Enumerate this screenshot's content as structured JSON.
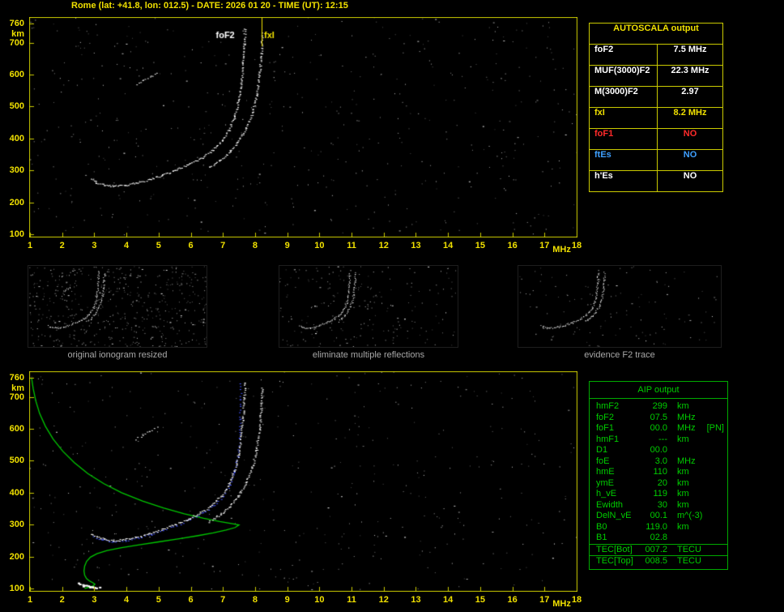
{
  "header": {
    "title": "Rome (lat: +41.8, lon: 012.5) - DATE: 2026 01 20 - TIME (UT): 12:15"
  },
  "colors": {
    "white": "#ffffff",
    "yellow": "#f0e000",
    "red": "#ff2a2a",
    "blue": "#3fa0ff",
    "axis_yellow": "#caca00",
    "green": "#00cc00",
    "green_border": "#00aa00",
    "profile_green": "#00c800",
    "fit_blue": "#4455ff",
    "caption_gray": "#a8a8a8"
  },
  "autoscala_table": {
    "title": "AUTOSCALA output",
    "rows": [
      {
        "label": "foF2",
        "value": "7.5 MHz",
        "color": "white"
      },
      {
        "label": "MUF(3000)F2",
        "value": "22.3 MHz",
        "color": "white"
      },
      {
        "label": "M(3000)F2",
        "value": "2.97",
        "color": "white"
      },
      {
        "label": "fxI",
        "value": "8.2 MHz",
        "color": "yellow"
      },
      {
        "label": "foF1",
        "value": "NO",
        "color": "red"
      },
      {
        "label": "ftEs",
        "value": "NO",
        "color": "blue"
      },
      {
        "label": "h'Es",
        "value": "NO",
        "color": "white"
      }
    ]
  },
  "thumbnails": [
    {
      "caption": "original ionogram resized"
    },
    {
      "caption": "eliminate multiple reflections"
    },
    {
      "caption": "evidence F2 trace"
    }
  ],
  "aip_table": {
    "title": "AIP output",
    "rows": [
      {
        "label": "hmF2",
        "value": "299",
        "unit": "km"
      },
      {
        "label": "foF2",
        "value": "07.5",
        "unit": "MHz"
      },
      {
        "label": "foF1",
        "value": "00.0",
        "unit": "MHz",
        "note": "[PN]"
      },
      {
        "label": "hmF1",
        "value": "---",
        "unit": "km"
      },
      {
        "label": "D1",
        "value": "00.0",
        "unit": ""
      },
      {
        "label": "foE",
        "value": "3.0",
        "unit": "MHz"
      },
      {
        "label": "hmE",
        "value": "110",
        "unit": "km"
      },
      {
        "label": "ymE",
        "value": "20",
        "unit": "km"
      },
      {
        "label": "h_vE",
        "value": "119",
        "unit": "km"
      },
      {
        "label": "Ewidth",
        "value": "30",
        "unit": "km"
      },
      {
        "label": "DelN_vE",
        "value": "00.1",
        "unit": "m^(-3)"
      },
      {
        "label": "B0",
        "value": "119.0",
        "unit": "km"
      },
      {
        "label": "B1",
        "value": "02.8",
        "unit": ""
      },
      {
        "label": "TEC[Bot]",
        "value": "007.2",
        "unit": "TECU",
        "sep": true
      },
      {
        "label": "TEC[Top]",
        "value": "008.5",
        "unit": "TECU",
        "sep": true
      }
    ]
  },
  "chart_data": [
    {
      "id": "scaled-ionogram",
      "type": "scatter",
      "xlabel": "MHz",
      "ylabel": "km",
      "xlim": [
        1,
        18
      ],
      "ylim": [
        100,
        760
      ],
      "x_ticks": [
        1,
        2,
        3,
        4,
        5,
        6,
        7,
        8,
        9,
        10,
        11,
        12,
        13,
        14,
        15,
        16,
        17,
        18
      ],
      "y_ticks": [
        760,
        700,
        600,
        500,
        400,
        300,
        200,
        100
      ],
      "key_values": {
        "foF2_MHz": 7.5,
        "fxI_MHz": 8.2
      },
      "annotations": [
        {
          "text": "foF2",
          "x": 6.78,
          "km": 722,
          "color": "#ffffff"
        },
        {
          "text": "fxI",
          "x": 8.28,
          "km": 722,
          "color": "#f0e000"
        }
      ],
      "markers": [
        {
          "x": 8.2,
          "km_to": 690,
          "color": "#f0e000"
        }
      ],
      "series": [
        {
          "name": "F2 O-mode echo trace",
          "color": "#ffffff",
          "style": "trace",
          "points": [
            [
              2.88,
              272
            ],
            [
              3.05,
              262
            ],
            [
              3.3,
              255
            ],
            [
              3.6,
              251
            ],
            [
              3.95,
              254
            ],
            [
              4.3,
              261
            ],
            [
              4.7,
              272
            ],
            [
              5.1,
              286
            ],
            [
              5.5,
              301
            ],
            [
              5.9,
              318
            ],
            [
              6.3,
              338
            ],
            [
              6.65,
              362
            ],
            [
              6.95,
              392
            ],
            [
              7.18,
              428
            ],
            [
              7.35,
              470
            ],
            [
              7.47,
              520
            ],
            [
              7.55,
              575
            ],
            [
              7.61,
              635
            ],
            [
              7.65,
              695
            ],
            [
              7.67,
              745
            ]
          ]
        },
        {
          "name": "F2 X-mode echo trace",
          "color": "#ffffff",
          "style": "trace",
          "points": [
            [
              6.55,
              310
            ],
            [
              6.9,
              332
            ],
            [
              7.2,
              358
            ],
            [
              7.45,
              390
            ],
            [
              7.7,
              432
            ],
            [
              7.9,
              480
            ],
            [
              8.03,
              535
            ],
            [
              8.12,
              600
            ],
            [
              8.18,
              665
            ],
            [
              8.21,
              730
            ]
          ]
        },
        {
          "name": "second-hop echo",
          "color": "#dcdcdc",
          "style": "trace",
          "step": 3,
          "points": [
            [
              4.28,
              568
            ],
            [
              4.5,
              582
            ],
            [
              4.72,
              594
            ],
            [
              4.95,
              606
            ]
          ]
        }
      ]
    },
    {
      "id": "ionogram-with-electron-density-profile",
      "type": "scatter",
      "xlabel": "MHz",
      "ylabel": "km",
      "xlim": [
        1,
        18
      ],
      "ylim": [
        100,
        760
      ],
      "x_ticks": [
        1,
        2,
        3,
        4,
        5,
        6,
        7,
        8,
        9,
        10,
        11,
        12,
        13,
        14,
        15,
        16,
        17,
        18
      ],
      "y_ticks": [
        760,
        700,
        600,
        500,
        400,
        300,
        200,
        100
      ],
      "key_values": {
        "hmF2_km": 299,
        "foF2_MHz": 7.5,
        "foE_MHz": 3.0,
        "hmE_km": 110
      },
      "annotations": [],
      "markers": [],
      "series": [
        {
          "name": "electron density profile",
          "color": "#00c800",
          "style": "line",
          "points": [
            [
              1.05,
              760
            ],
            [
              1.1,
              726
            ],
            [
              1.18,
              688
            ],
            [
              1.3,
              648
            ],
            [
              1.48,
              608
            ],
            [
              1.72,
              568
            ],
            [
              2.02,
              530
            ],
            [
              2.38,
              494
            ],
            [
              2.8,
              460
            ],
            [
              3.3,
              428
            ],
            [
              3.85,
              400
            ],
            [
              4.5,
              374
            ],
            [
              5.15,
              352
            ],
            [
              5.8,
              334
            ],
            [
              6.4,
              320
            ],
            [
              6.9,
              310
            ],
            [
              7.3,
              303
            ],
            [
              7.5,
              299
            ],
            [
              7.38,
              291
            ],
            [
              7.1,
              283
            ],
            [
              6.7,
              274
            ],
            [
              6.2,
              265
            ],
            [
              5.6,
              255
            ],
            [
              5.0,
              246
            ],
            [
              4.4,
              237
            ],
            [
              3.85,
              228
            ],
            [
              3.4,
              219
            ],
            [
              3.08,
              209
            ],
            [
              2.88,
              198
            ],
            [
              2.76,
              185
            ],
            [
              2.7,
              170
            ],
            [
              2.68,
              155
            ],
            [
              2.7,
              142
            ],
            [
              2.76,
              131
            ],
            [
              2.86,
              123
            ],
            [
              2.97,
              117
            ],
            [
              3.02,
              113
            ],
            [
              2.96,
              108
            ],
            [
              2.84,
              104
            ],
            [
              2.7,
              100
            ]
          ]
        },
        {
          "name": "AUTOSCALA fitted trace",
          "color": "#4455ff",
          "style": "trace",
          "step": 4,
          "points": [
            [
              2.95,
              262
            ],
            [
              3.2,
              253
            ],
            [
              3.55,
              248
            ],
            [
              3.95,
              251
            ],
            [
              4.35,
              259
            ],
            [
              4.75,
              270
            ],
            [
              5.15,
              284
            ],
            [
              5.55,
              299
            ],
            [
              5.95,
              316
            ],
            [
              6.35,
              336
            ],
            [
              6.7,
              360
            ],
            [
              7.0,
              390
            ],
            [
              7.2,
              425
            ],
            [
              7.35,
              465
            ],
            [
              7.45,
              515
            ],
            [
              7.5,
              570
            ],
            [
              7.52,
              630
            ],
            [
              7.53,
              690
            ],
            [
              7.54,
              745
            ]
          ]
        },
        {
          "name": "F2 O-mode echo trace",
          "color": "#ffffff",
          "style": "trace",
          "points": [
            [
              2.88,
              272
            ],
            [
              3.05,
              262
            ],
            [
              3.3,
              255
            ],
            [
              3.6,
              251
            ],
            [
              3.95,
              254
            ],
            [
              4.3,
              261
            ],
            [
              4.7,
              272
            ],
            [
              5.1,
              286
            ],
            [
              5.5,
              301
            ],
            [
              5.9,
              318
            ],
            [
              6.3,
              338
            ],
            [
              6.65,
              362
            ],
            [
              6.95,
              392
            ],
            [
              7.18,
              428
            ],
            [
              7.35,
              470
            ],
            [
              7.47,
              520
            ],
            [
              7.55,
              575
            ],
            [
              7.61,
              635
            ],
            [
              7.65,
              695
            ],
            [
              7.67,
              745
            ]
          ]
        },
        {
          "name": "F2 X-mode echo trace",
          "color": "#ffffff",
          "style": "trace",
          "points": [
            [
              6.55,
              310
            ],
            [
              6.9,
              332
            ],
            [
              7.2,
              358
            ],
            [
              7.45,
              390
            ],
            [
              7.7,
              432
            ],
            [
              7.9,
              480
            ],
            [
              8.03,
              535
            ],
            [
              8.12,
              600
            ],
            [
              8.18,
              665
            ],
            [
              8.21,
              730
            ]
          ]
        },
        {
          "name": "second-hop echo",
          "color": "#dcdcdc",
          "style": "trace",
          "step": 3,
          "points": [
            [
              4.28,
              568
            ],
            [
              4.5,
              582
            ],
            [
              4.72,
              594
            ],
            [
              4.95,
              606
            ]
          ]
        },
        {
          "name": "E-region echo",
          "color": "#ffffff",
          "style": "trace",
          "size": 3,
          "points": [
            [
              2.5,
              116
            ],
            [
              2.66,
              110
            ],
            [
              2.82,
              106
            ],
            [
              3.0,
              104
            ],
            [
              3.12,
              103
            ]
          ]
        }
      ]
    }
  ]
}
